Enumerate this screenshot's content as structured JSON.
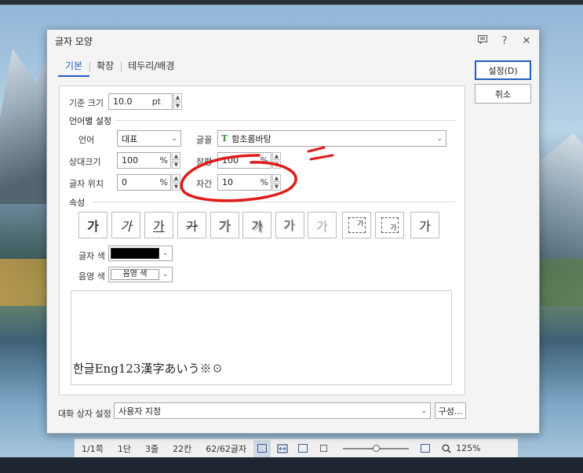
{
  "dialog": {
    "title": "글자 모양",
    "titlebar_icons": [
      "comment-icon",
      "help-icon",
      "close-icon"
    ],
    "help_glyph": "?",
    "close_glyph": "✕",
    "tabs": [
      {
        "label": "기본",
        "active": true
      },
      {
        "label": "확장",
        "active": false
      },
      {
        "label": "테두리/배경",
        "active": false
      }
    ],
    "buttons": {
      "ok": "설정(D)",
      "cancel": "취소"
    }
  },
  "base_size": {
    "label": "기준 크기",
    "value": "10.0",
    "unit": "pt"
  },
  "lang_section": {
    "title": "언어별 설정",
    "language": {
      "label": "언어",
      "value": "대표"
    },
    "font": {
      "label": "글꼴",
      "value": "함초롬바탕",
      "icon": "truetype-font-icon",
      "icon_glyph": "T"
    },
    "relative_size": {
      "label": "상대크기",
      "value": "100",
      "unit": "%"
    },
    "width_ratio": {
      "label": "장평",
      "value": "100",
      "unit": "%"
    },
    "position": {
      "label": "글자 위치",
      "value": "0",
      "unit": "%"
    },
    "spacing": {
      "label": "자간",
      "value": "10",
      "unit": "%"
    }
  },
  "attributes": {
    "title": "속성",
    "glyph": "가",
    "small_glyph": "가",
    "buttons": [
      "bold",
      "italic",
      "underline",
      "strikethrough",
      "outline",
      "shadow",
      "emboss",
      "engrave",
      "superscript",
      "subscript",
      "normal"
    ]
  },
  "text_color": {
    "label": "글자 색",
    "value": "#000000"
  },
  "shade_color": {
    "label": "음영 색",
    "value": "음영 색"
  },
  "preview_text": "한글Eng123漢字あいう※☉",
  "dialog_settings": {
    "label": "대화 상자 설정",
    "value": "사용자 지정",
    "configure": "구성..."
  },
  "statusbar": {
    "page": "1/1쪽",
    "column": "1단",
    "line": "3줄",
    "char": "22칸",
    "count": "62/62글자",
    "zoom": "125%",
    "zoom_level": 0.5
  },
  "colors": {
    "accent": "#1f5fbf",
    "annotation": "#e01b1b"
  }
}
